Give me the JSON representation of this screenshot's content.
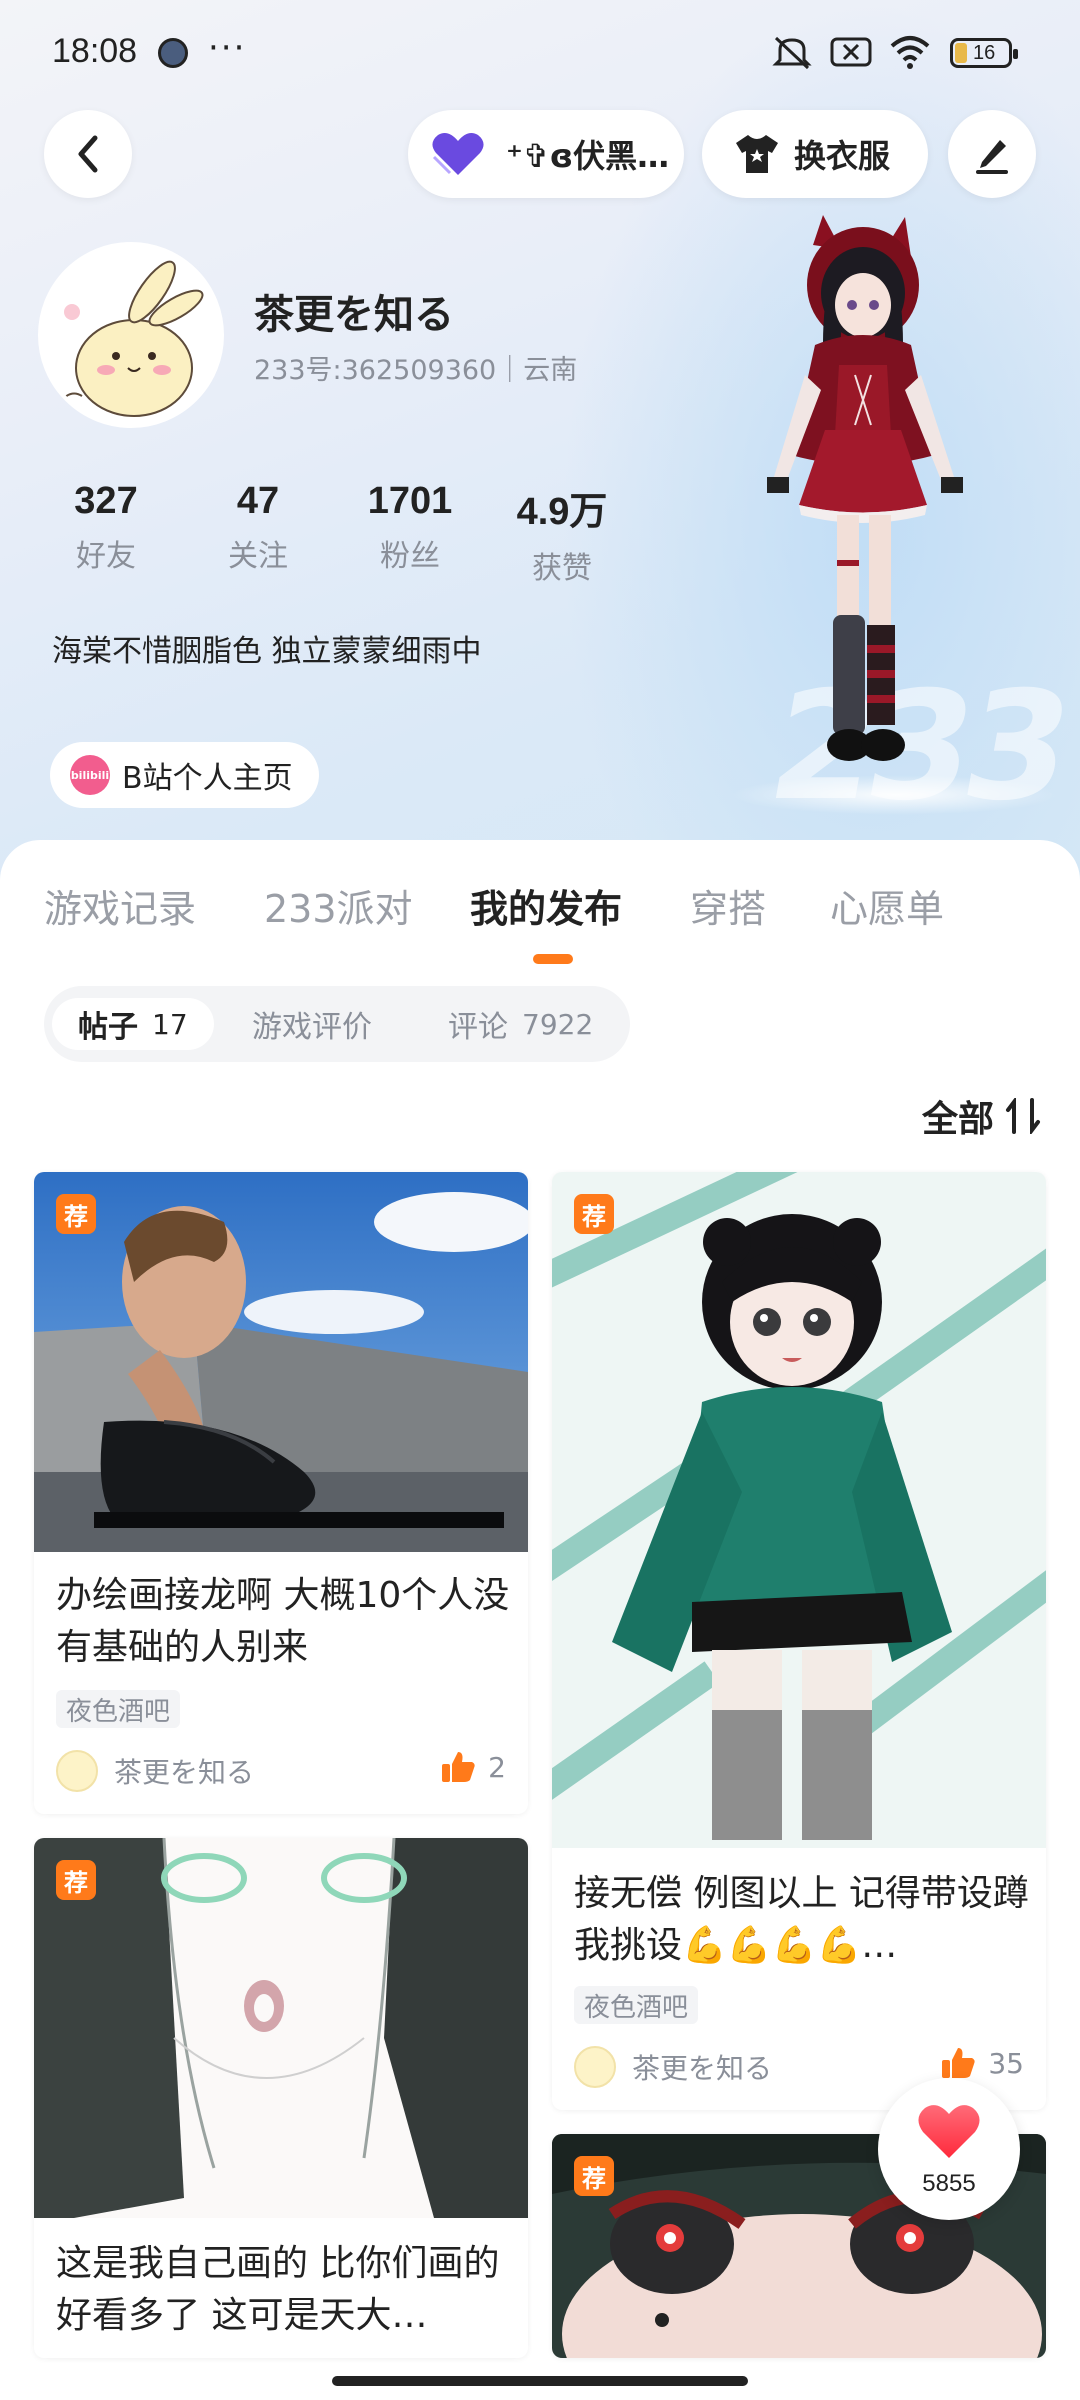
{
  "status_bar": {
    "time": "18:08",
    "battery": "16"
  },
  "header": {
    "group_label": "⁺✞ɞ伏黑…",
    "outfit_label": "换衣服"
  },
  "profile": {
    "name": "茶更を知る",
    "uid": "233号:362509360｜云南",
    "stats": [
      {
        "num": "327",
        "label": "好友"
      },
      {
        "num": "47",
        "label": "关注"
      },
      {
        "num": "1701",
        "label": "粉丝"
      },
      {
        "num": "4.9万",
        "label": "获赞"
      }
    ],
    "bio": "海棠不惜胭脂色 独立蒙蒙细雨中",
    "bili_logo": "bilibili",
    "bili_link": "B站个人主页"
  },
  "tabs": [
    "游戏记录",
    "233派对",
    "我的发布",
    "穿搭",
    "心愿单"
  ],
  "subtabs": {
    "posts_label": "帖子",
    "posts_count": "17",
    "reviews_label": "游戏评价",
    "comments_label": "评论",
    "comments_count": "7922"
  },
  "sort_label": "全部",
  "posts": [
    {
      "badge": "荐",
      "title": "办绘画接龙啊 大概10个人没有基础的人别来",
      "tag": "夜色酒吧",
      "author": "茶更を知る",
      "likes": "2"
    },
    {
      "badge": "荐",
      "title": "接无偿 例图以上 记得带设蹲 我挑设💪💪💪💪…",
      "tag": "夜色酒吧",
      "author": "茶更を知る",
      "likes": "35"
    },
    {
      "badge": "荐",
      "title": "这是我自己画的 比你们画的好看多了 这可是天大…"
    },
    {
      "badge": "荐"
    }
  ],
  "fab": {
    "count": "5855"
  },
  "colors": {
    "accent": "#ff7a1a",
    "like_heart": "#ff3d4f",
    "bilibili": "#f25d8e"
  }
}
